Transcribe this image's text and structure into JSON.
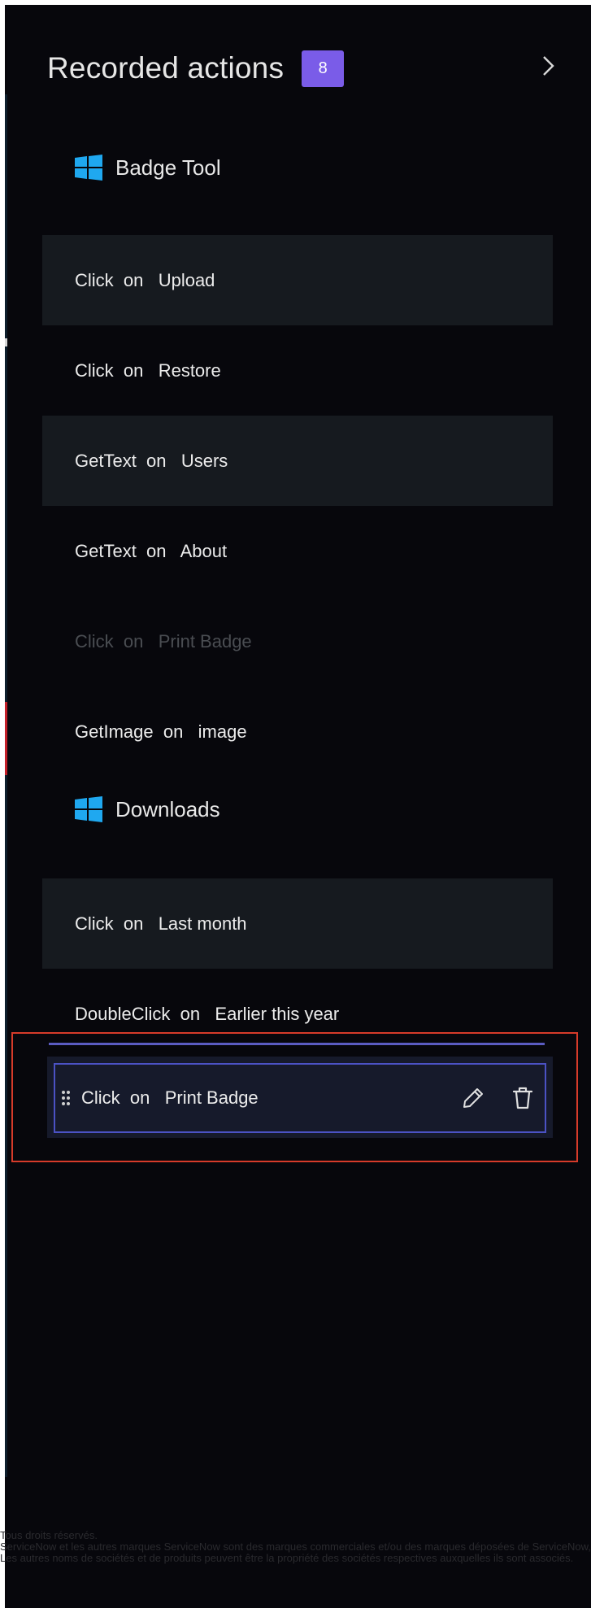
{
  "header": {
    "title": "Recorded actions",
    "count_badge": "8",
    "collapse_icon": "chevron-right-icon"
  },
  "groups": [
    {
      "label": "Badge Tool",
      "icon": "windows-logo-icon",
      "actions": [
        {
          "text": "Click  on   Upload",
          "shaded": true,
          "dimmed": false
        },
        {
          "text": "Click  on   Restore",
          "shaded": false,
          "dimmed": false
        },
        {
          "text": "GetText  on   Users",
          "shaded": true,
          "dimmed": false
        },
        {
          "text": "GetText  on   About",
          "shaded": false,
          "dimmed": false
        },
        {
          "text": "Click  on   Print Badge",
          "shaded": false,
          "dimmed": true
        },
        {
          "text": "GetImage  on   image",
          "shaded": false,
          "dimmed": false
        }
      ]
    },
    {
      "label": "Downloads",
      "icon": "windows-logo-icon",
      "actions": [
        {
          "text": "Click  on   Last month",
          "shaded": true,
          "dimmed": false
        },
        {
          "text": "DoubleClick  on   Earlier this year",
          "shaded": false,
          "dimmed": false
        }
      ]
    }
  ],
  "dragged_action": {
    "text": "Click  on   Print Badge",
    "handle_icon": "drag-handle-icon",
    "edit_icon": "pencil-icon",
    "delete_icon": "trash-icon"
  },
  "colors": {
    "panel_bg": "#07070c",
    "row_shaded": "#161a1f",
    "badge": "#7a5ce8",
    "drop_indicator": "#5b5cc2",
    "highlight": "#d63b2a"
  },
  "footer": {
    "line1": "Tous droits réservés.",
    "line2": "ServiceNow et les autres marques ServiceNow sont des marques commerciales et/ou des marques déposées de ServiceNow, Inc. aux États-Unis et/ou dans d'autres pays.",
    "line3": "Les autres noms de sociétés et de produits peuvent être la propriété des sociétés respectives auxquelles ils sont associés."
  }
}
